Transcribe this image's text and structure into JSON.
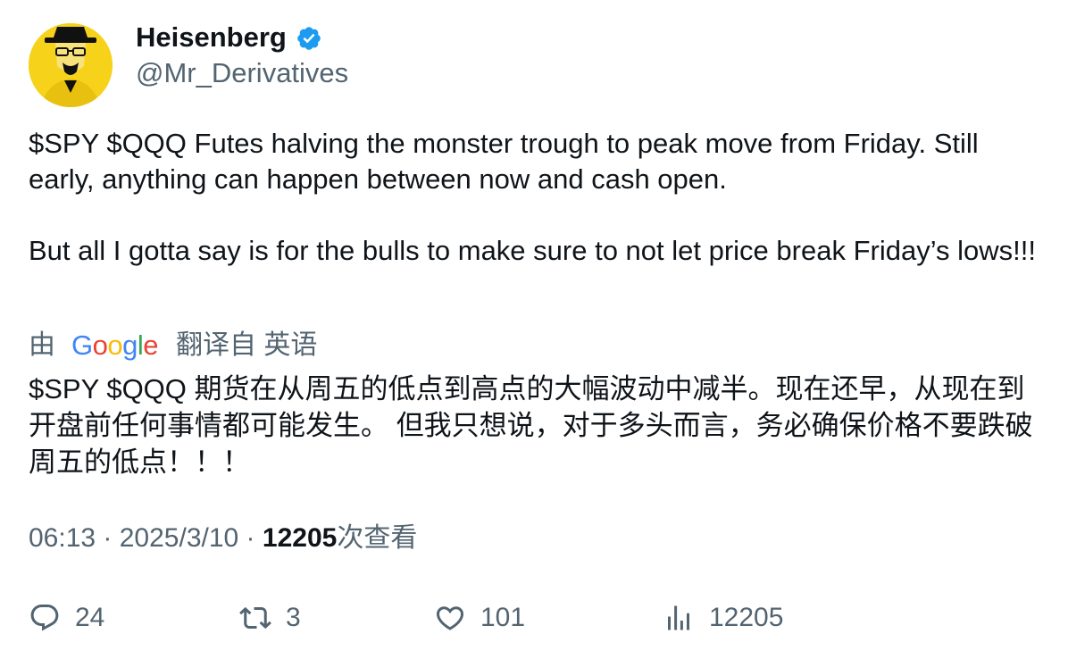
{
  "author": {
    "display_name": "Heisenberg",
    "handle": "@Mr_Derivatives",
    "verified_icon": "verified-badge-icon",
    "avatar_icon": "heisenberg-avatar-icon"
  },
  "tweet": {
    "paragraphs": [
      "$SPY $QQQ Futes halving the monster trough to peak move from Friday. Still early, anything can happen between now and cash open.",
      "But all I gotta say is for the bulls to make sure to not let price break Friday’s lows!!!"
    ]
  },
  "translation": {
    "by_label": "由",
    "google_logo_text": "Google",
    "translated_from": "翻译自 英语",
    "text": "$SPY $QQQ 期货在从周五的低点到高点的大幅波动中减半。现在还早，从现在到开盘前任何事情都可能发生。 但我只想说，对于多头而言，务必确保价格不要跌破周五的低点！！！"
  },
  "meta": {
    "time": "06:13",
    "separator": " · ",
    "date": "2025/3/10",
    "views_count": "12205",
    "views_label": "次查看"
  },
  "actions": {
    "replies": "24",
    "retweets": "3",
    "likes": "101",
    "views": "12205"
  },
  "colors": {
    "text_primary": "#0f1419",
    "text_secondary": "#536471",
    "verified_blue": "#1d9bf0",
    "avatar_yellow": "#f6d21b",
    "google_blue": "#4285f4",
    "google_red": "#ea4335",
    "google_yellow": "#fbbc05",
    "google_green": "#34a853"
  }
}
